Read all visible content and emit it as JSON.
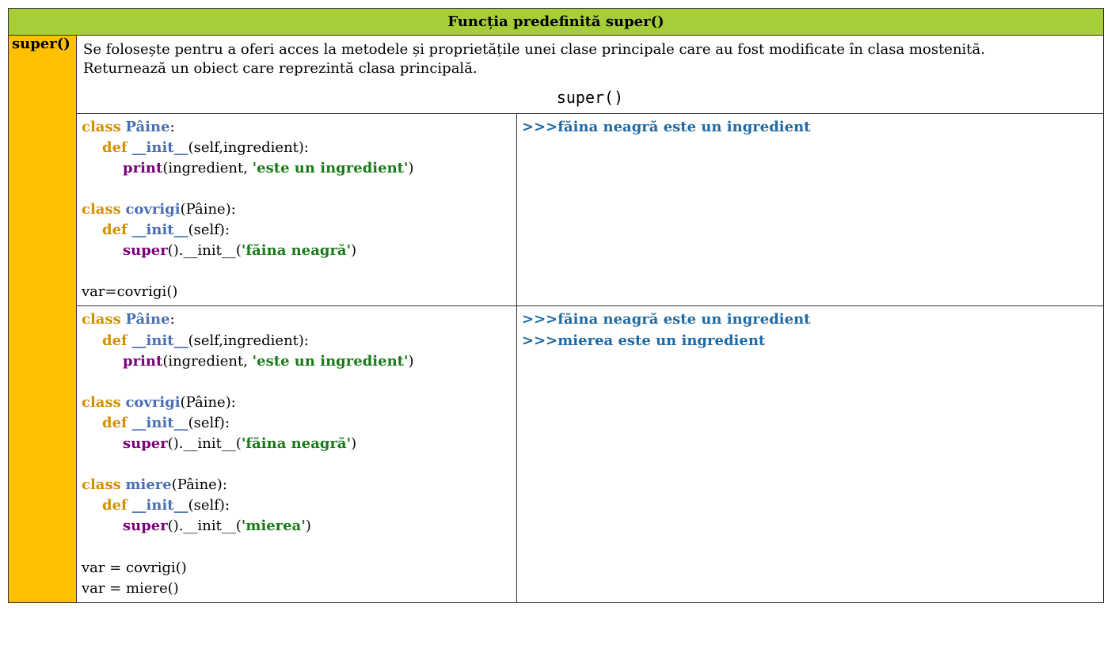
{
  "header": {
    "title": "Funcția predefinită super()"
  },
  "label": "super()",
  "description": {
    "line1": "Se folosește pentru a oferi acces la metodele și proprietățile unei clase principale care au fost modificate în clasa mostenită.",
    "line2": "Returnează un obiect care reprezintă clasa principală.",
    "syntax": "super()"
  },
  "tokens": {
    "class": "class",
    "def": "def",
    "Paine": "Pâine",
    "covrigi": "covrigi",
    "miere": "miere",
    "init": "__init__",
    "print": "print",
    "super": "super",
    "self_ing": "(self,ingredient):",
    "self_only": "(self):",
    "colon": ":",
    "paine_paren": "(Pâine):",
    "print_open": "(ingredient, ",
    "print_close": ")",
    "str_ing": "'este un ingredient'",
    "super_call_open": "().__init__(",
    "super_call_close": ")",
    "str_faina": "'făina neagră'",
    "str_miere": "'mierea'",
    "var_covrigi_tight": "var=covrigi()",
    "var_covrigi": "var = covrigi()",
    "var_miere": "var = miere()"
  },
  "output": {
    "prompt": ">>>",
    "faina": "făina neagră este un ingredient",
    "miere": "mierea este un ingredient"
  }
}
